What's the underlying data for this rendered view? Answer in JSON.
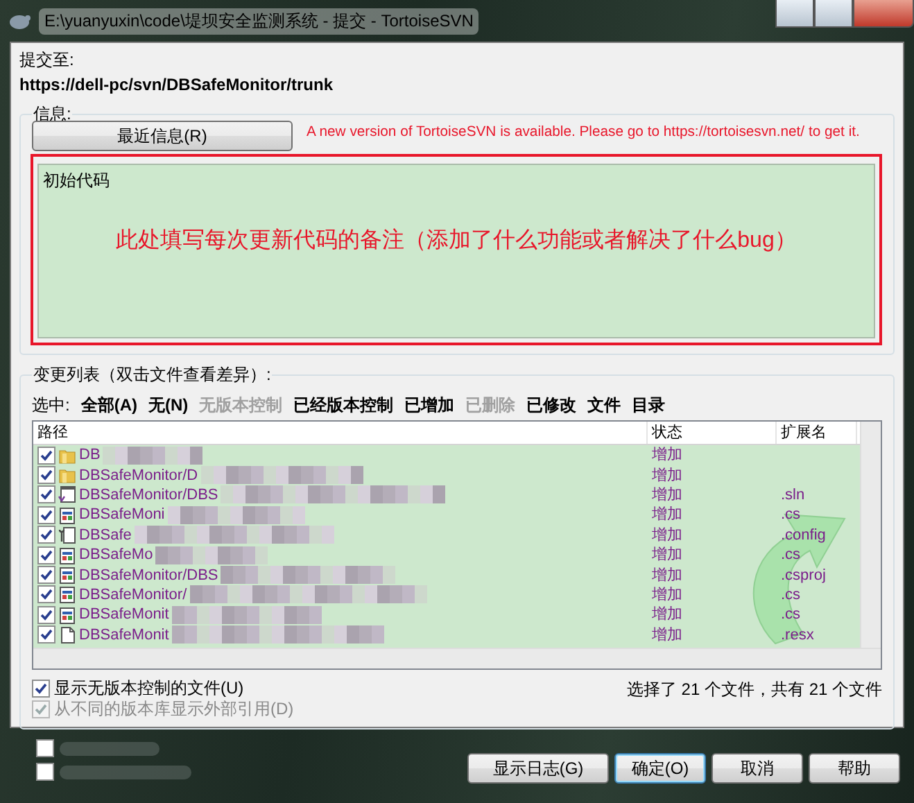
{
  "window": {
    "title": "E:\\yuanyuxin\\code\\堤坝安全监测系统 - 提交 - TortoiseSVN"
  },
  "commit_to": {
    "label": "提交至:",
    "url": "https://dell-pc/svn/DBSafeMonitor/trunk"
  },
  "message": {
    "group_label": "信息:",
    "recent_button": "最近信息(R)",
    "update_notice": "A new version of TortoiseSVN is available. Please go to https://tortoisesvn.net/ to get it.",
    "value": "初始代码",
    "annotation": "此处填写每次更新代码的备注（添加了什么功能或者解决了什么bug）"
  },
  "changes": {
    "group_label": "变更列表（双击文件查看差异）:",
    "select_label": "选中:",
    "filters": [
      {
        "label": "全部(A)",
        "disabled": false
      },
      {
        "label": "无(N)",
        "disabled": false
      },
      {
        "label": "无版本控制",
        "disabled": true
      },
      {
        "label": "已经版本控制",
        "disabled": false
      },
      {
        "label": "已增加",
        "disabled": false
      },
      {
        "label": "已删除",
        "disabled": true
      },
      {
        "label": "已修改",
        "disabled": false
      },
      {
        "label": "文件",
        "disabled": false
      },
      {
        "label": "目录",
        "disabled": false
      }
    ],
    "columns": [
      "路径",
      "状态",
      "扩展名"
    ],
    "rows": [
      {
        "checked": true,
        "kind": "folder",
        "path": "DB",
        "status": "增加"
      },
      {
        "checked": true,
        "kind": "folder",
        "path": "DBSafeMonitor/D",
        "status": "增加"
      },
      {
        "checked": true,
        "kind": "solution",
        "path": "DBSafeMonitor/DBS",
        "status": "增加",
        "extension": ".sln"
      },
      {
        "checked": true,
        "kind": "code",
        "path": "DBSafeMoni",
        "status": "增加",
        "extension": ".cs"
      },
      {
        "checked": true,
        "kind": "config",
        "path": "DBSafe",
        "status": "增加",
        "extension": ".config"
      },
      {
        "checked": true,
        "kind": "code",
        "path": "DBSafeMo",
        "status": "增加",
        "extension": ".cs"
      },
      {
        "checked": true,
        "kind": "code",
        "path": "DBSafeMonitor/DBS",
        "status": "增加",
        "extension": ".csproj"
      },
      {
        "checked": true,
        "kind": "code",
        "path": "DBSafeMonitor/",
        "status": "增加",
        "extension": ".cs"
      },
      {
        "checked": true,
        "kind": "code",
        "path": "DBSafeMonit",
        "status": "增加",
        "extension": ".cs"
      },
      {
        "checked": true,
        "kind": "document",
        "path": "DBSafeMonit",
        "status": "增加",
        "extension": ".resx"
      }
    ],
    "show_unversioned": {
      "label": "显示无版本控制的文件(U)",
      "checked": true,
      "disabled": false
    },
    "show_externals": {
      "label": "从不同的版本库显示外部引用(D)",
      "checked": true,
      "disabled": true
    },
    "summary": "选择了 21 个文件，共有 21 个文件"
  },
  "options": [
    {
      "checked": false
    },
    {
      "checked": false
    }
  ],
  "buttons": [
    {
      "label": "显示日志(G)",
      "default": false
    },
    {
      "label": "确定(O)",
      "default": true
    },
    {
      "label": "取消",
      "default": false
    },
    {
      "label": "帮助",
      "default": false
    }
  ]
}
